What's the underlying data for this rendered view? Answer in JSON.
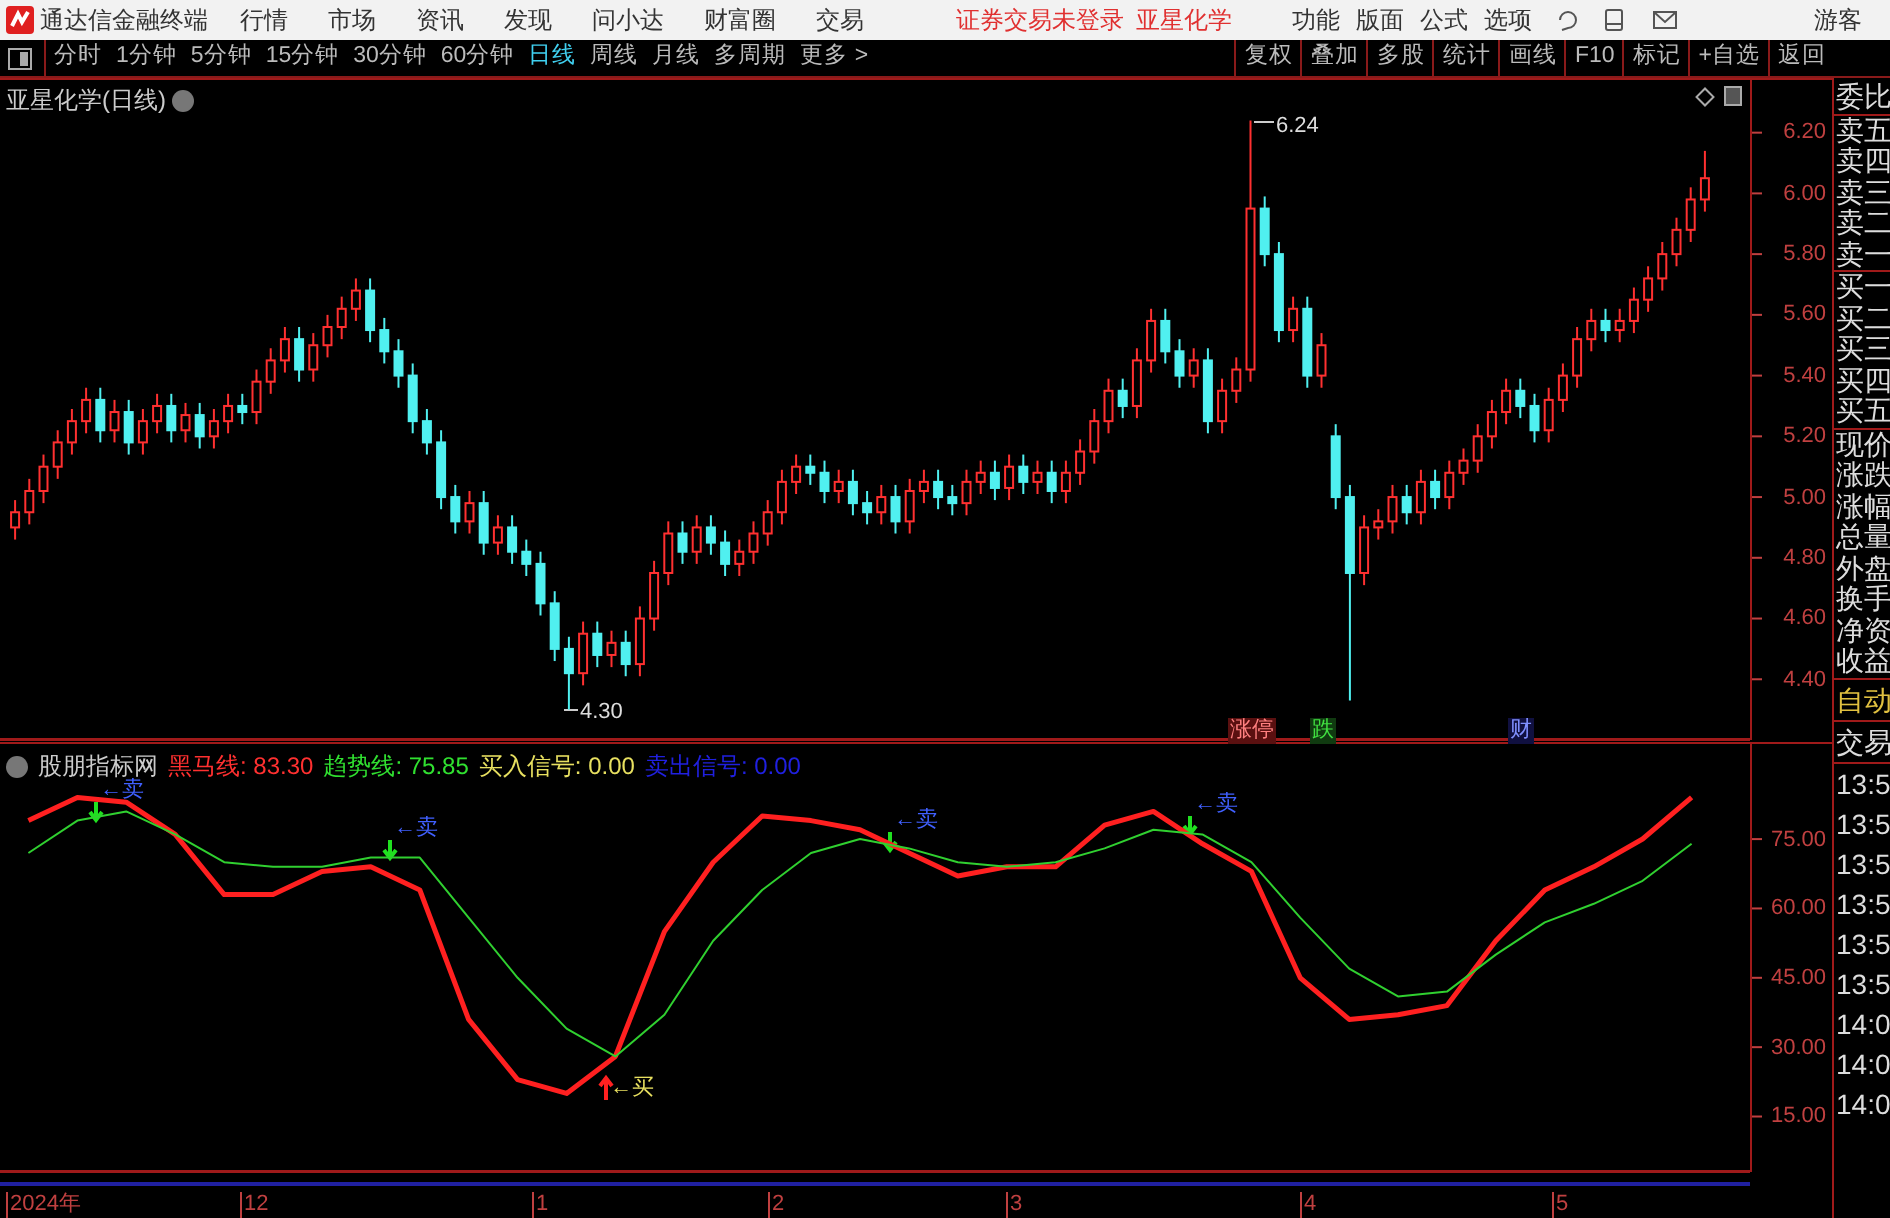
{
  "window": {
    "title": "通达信金融终端"
  },
  "menu": [
    "行情",
    "市场",
    "资讯",
    "发现",
    "问小达",
    "财富圈",
    "交易"
  ],
  "login_status": "证券交易未登录",
  "stock_name": "亚星化学",
  "right_menu": [
    "功能",
    "版面",
    "公式",
    "选项"
  ],
  "user": "游客",
  "periods": [
    {
      "label": "分时",
      "selected": false
    },
    {
      "label": "1分钟",
      "selected": false
    },
    {
      "label": "5分钟",
      "selected": false
    },
    {
      "label": "15分钟",
      "selected": false
    },
    {
      "label": "30分钟",
      "selected": false
    },
    {
      "label": "60分钟",
      "selected": false
    },
    {
      "label": "日线",
      "selected": true
    },
    {
      "label": "周线",
      "selected": false
    },
    {
      "label": "月线",
      "selected": false
    },
    {
      "label": "多周期",
      "selected": false
    },
    {
      "label": "更多 >",
      "selected": false
    }
  ],
  "tools": [
    "复权",
    "叠加",
    "多股",
    "统计",
    "画线",
    "F10",
    "标记",
    "+自选",
    "返回"
  ],
  "chart": {
    "title": "亚星化学(日线)",
    "high_label": "6.24",
    "low_label": "4.30",
    "event_tags": [
      {
        "label": "涨停",
        "kind": "limit_up"
      },
      {
        "label": "跌",
        "kind": "drop"
      },
      {
        "label": "财",
        "kind": "finance"
      }
    ],
    "chart_data": {
      "type": "candlestick",
      "ylim": [
        4.2,
        6.38
      ],
      "yticks": [
        {
          "value": 6.2,
          "label": "6.20"
        },
        {
          "value": 6.0,
          "label": "6.00"
        },
        {
          "value": 5.8,
          "label": "5.80"
        },
        {
          "value": 5.6,
          "label": "5.60"
        },
        {
          "value": 5.4,
          "label": "5.40"
        },
        {
          "value": 5.2,
          "label": "5.20"
        },
        {
          "value": 5.0,
          "label": "5.00"
        },
        {
          "value": 4.8,
          "label": "4.80"
        },
        {
          "value": 4.6,
          "label": "4.60"
        },
        {
          "value": 4.4,
          "label": "4.40"
        }
      ],
      "categories": [
        null,
        null,
        null,
        null,
        null,
        null,
        null,
        null,
        null,
        null,
        null,
        null,
        null,
        null,
        null,
        null,
        null,
        null,
        null,
        null,
        null,
        null,
        null,
        null,
        null,
        null,
        null,
        null,
        null,
        null,
        null,
        null,
        null,
        null,
        null,
        null,
        null,
        null,
        null,
        null,
        null,
        null,
        null,
        null,
        null,
        null,
        null,
        null,
        null,
        null,
        null,
        null,
        null,
        null,
        null,
        null,
        null,
        null,
        null,
        null,
        null,
        null,
        null,
        null,
        null,
        null,
        null,
        null,
        null,
        null,
        null,
        null,
        null,
        null,
        null,
        null,
        null,
        null,
        null,
        null,
        null,
        null,
        null,
        null,
        null,
        null,
        null,
        null,
        null,
        null,
        null,
        null,
        null,
        null,
        null,
        null,
        null,
        null,
        null,
        null,
        null,
        null,
        null,
        null,
        null,
        null,
        null,
        null,
        null,
        null,
        null,
        null,
        null,
        null,
        null,
        null,
        null,
        null,
        null,
        null
      ],
      "ohlc": [
        [
          4.9,
          4.99,
          4.86,
          4.95
        ],
        [
          4.95,
          5.06,
          4.91,
          5.02
        ],
        [
          5.02,
          5.14,
          4.98,
          5.1
        ],
        [
          5.1,
          5.22,
          5.06,
          5.18
        ],
        [
          5.18,
          5.29,
          5.14,
          5.25
        ],
        [
          5.25,
          5.36,
          5.21,
          5.32
        ],
        [
          5.32,
          5.36,
          5.18,
          5.22
        ],
        [
          5.22,
          5.32,
          5.18,
          5.28
        ],
        [
          5.28,
          5.32,
          5.14,
          5.18
        ],
        [
          5.18,
          5.29,
          5.14,
          5.25
        ],
        [
          5.25,
          5.34,
          5.21,
          5.3
        ],
        [
          5.3,
          5.34,
          5.18,
          5.22
        ],
        [
          5.22,
          5.31,
          5.18,
          5.27
        ],
        [
          5.27,
          5.31,
          5.16,
          5.2
        ],
        [
          5.2,
          5.29,
          5.16,
          5.25
        ],
        [
          5.25,
          5.34,
          5.21,
          5.3
        ],
        [
          5.3,
          5.34,
          5.24,
          5.28
        ],
        [
          5.28,
          5.42,
          5.24,
          5.38
        ],
        [
          5.38,
          5.49,
          5.34,
          5.45
        ],
        [
          5.45,
          5.56,
          5.41,
          5.52
        ],
        [
          5.52,
          5.56,
          5.38,
          5.42
        ],
        [
          5.42,
          5.54,
          5.38,
          5.5
        ],
        [
          5.5,
          5.6,
          5.46,
          5.56
        ],
        [
          5.56,
          5.66,
          5.52,
          5.62
        ],
        [
          5.62,
          5.72,
          5.58,
          5.68
        ],
        [
          5.68,
          5.72,
          5.51,
          5.55
        ],
        [
          5.55,
          5.59,
          5.44,
          5.48
        ],
        [
          5.48,
          5.52,
          5.36,
          5.4
        ],
        [
          5.4,
          5.44,
          5.21,
          5.25
        ],
        [
          5.25,
          5.29,
          5.14,
          5.18
        ],
        [
          5.18,
          5.22,
          4.96,
          5.0
        ],
        [
          5.0,
          5.04,
          4.88,
          4.92
        ],
        [
          4.92,
          5.02,
          4.88,
          4.98
        ],
        [
          4.98,
          5.02,
          4.81,
          4.85
        ],
        [
          4.85,
          4.94,
          4.81,
          4.9
        ],
        [
          4.9,
          4.94,
          4.78,
          4.82
        ],
        [
          4.82,
          4.86,
          4.74,
          4.78
        ],
        [
          4.78,
          4.82,
          4.61,
          4.65
        ],
        [
          4.65,
          4.69,
          4.46,
          4.5
        ],
        [
          4.5,
          4.54,
          4.3,
          4.42
        ],
        [
          4.42,
          4.59,
          4.38,
          4.55
        ],
        [
          4.55,
          4.59,
          4.44,
          4.48
        ],
        [
          4.48,
          4.56,
          4.44,
          4.52
        ],
        [
          4.52,
          4.56,
          4.41,
          4.45
        ],
        [
          4.45,
          4.64,
          4.41,
          4.6
        ],
        [
          4.6,
          4.79,
          4.56,
          4.75
        ],
        [
          4.75,
          4.92,
          4.71,
          4.88
        ],
        [
          4.88,
          4.92,
          4.78,
          4.82
        ],
        [
          4.82,
          4.94,
          4.78,
          4.9
        ],
        [
          4.9,
          4.94,
          4.81,
          4.85
        ],
        [
          4.85,
          4.89,
          4.74,
          4.78
        ],
        [
          4.78,
          4.86,
          4.74,
          4.82
        ],
        [
          4.82,
          4.92,
          4.78,
          4.88
        ],
        [
          4.88,
          4.99,
          4.84,
          4.95
        ],
        [
          4.95,
          5.09,
          4.91,
          5.05
        ],
        [
          5.05,
          5.14,
          5.01,
          5.1
        ],
        [
          5.1,
          5.14,
          5.04,
          5.08
        ],
        [
          5.08,
          5.12,
          4.98,
          5.02
        ],
        [
          5.02,
          5.09,
          4.98,
          5.05
        ],
        [
          5.05,
          5.09,
          4.94,
          4.98
        ],
        [
          4.98,
          5.02,
          4.91,
          4.95
        ],
        [
          4.95,
          5.04,
          4.91,
          5.0
        ],
        [
          5.0,
          5.04,
          4.88,
          4.92
        ],
        [
          4.92,
          5.06,
          4.88,
          5.02
        ],
        [
          5.02,
          5.09,
          4.98,
          5.05
        ],
        [
          5.05,
          5.09,
          4.96,
          5.0
        ],
        [
          5.0,
          5.04,
          4.94,
          4.98
        ],
        [
          4.98,
          5.09,
          4.94,
          5.05
        ],
        [
          5.05,
          5.12,
          5.01,
          5.08
        ],
        [
          5.08,
          5.12,
          4.99,
          5.03
        ],
        [
          5.03,
          5.14,
          4.99,
          5.1
        ],
        [
          5.1,
          5.14,
          5.01,
          5.05
        ],
        [
          5.05,
          5.12,
          5.01,
          5.08
        ],
        [
          5.08,
          5.12,
          4.98,
          5.02
        ],
        [
          5.02,
          5.12,
          4.98,
          5.08
        ],
        [
          5.08,
          5.19,
          5.04,
          5.15
        ],
        [
          5.15,
          5.29,
          5.11,
          5.25
        ],
        [
          5.25,
          5.39,
          5.21,
          5.35
        ],
        [
          5.35,
          5.39,
          5.26,
          5.3
        ],
        [
          5.3,
          5.49,
          5.26,
          5.45
        ],
        [
          5.45,
          5.62,
          5.41,
          5.58
        ],
        [
          5.58,
          5.62,
          5.44,
          5.48
        ],
        [
          5.48,
          5.52,
          5.36,
          5.4
        ],
        [
          5.4,
          5.49,
          5.36,
          5.45
        ],
        [
          5.45,
          5.49,
          5.21,
          5.25
        ],
        [
          5.25,
          5.39,
          5.21,
          5.35
        ],
        [
          5.35,
          5.46,
          5.31,
          5.42
        ],
        [
          5.42,
          6.24,
          5.38,
          5.95
        ],
        [
          5.95,
          5.99,
          5.76,
          5.8
        ],
        [
          5.8,
          5.84,
          5.51,
          5.55
        ],
        [
          5.55,
          5.66,
          5.51,
          5.62
        ],
        [
          5.62,
          5.66,
          5.36,
          5.4
        ],
        [
          5.4,
          5.54,
          5.36,
          5.5
        ],
        [
          5.2,
          5.24,
          4.96,
          5.0
        ],
        [
          5.0,
          5.04,
          4.33,
          4.75
        ],
        [
          4.75,
          4.94,
          4.71,
          4.9
        ],
        [
          4.9,
          4.96,
          4.86,
          4.92
        ],
        [
          4.92,
          5.04,
          4.88,
          5.0
        ],
        [
          5.0,
          5.04,
          4.91,
          4.95
        ],
        [
          4.95,
          5.09,
          4.91,
          5.05
        ],
        [
          5.05,
          5.09,
          4.96,
          5.0
        ],
        [
          5.0,
          5.12,
          4.96,
          5.08
        ],
        [
          5.08,
          5.16,
          5.04,
          5.12
        ],
        [
          5.12,
          5.24,
          5.08,
          5.2
        ],
        [
          5.2,
          5.32,
          5.16,
          5.28
        ],
        [
          5.28,
          5.39,
          5.24,
          5.35
        ],
        [
          5.35,
          5.39,
          5.26,
          5.3
        ],
        [
          5.3,
          5.34,
          5.18,
          5.22
        ],
        [
          5.22,
          5.36,
          5.18,
          5.32
        ],
        [
          5.32,
          5.44,
          5.28,
          5.4
        ],
        [
          5.4,
          5.56,
          5.36,
          5.52
        ],
        [
          5.52,
          5.62,
          5.48,
          5.58
        ],
        [
          5.58,
          5.62,
          5.51,
          5.55
        ],
        [
          5.55,
          5.62,
          5.51,
          5.58
        ],
        [
          5.58,
          5.69,
          5.54,
          5.65
        ],
        [
          5.65,
          5.76,
          5.61,
          5.72
        ],
        [
          5.72,
          5.84,
          5.68,
          5.8
        ],
        [
          5.8,
          5.92,
          5.76,
          5.88
        ],
        [
          5.88,
          6.02,
          5.84,
          5.98
        ],
        [
          5.98,
          6.14,
          5.94,
          6.05
        ]
      ]
    }
  },
  "indicator": {
    "name": "股朋指标网",
    "legend": [
      {
        "label": "黑马线: 83.30",
        "color": "#ff3030"
      },
      {
        "label": "趋势线: 75.85",
        "color": "#30e030"
      },
      {
        "label": "买入信号: 0.00",
        "color": "#e8e060"
      },
      {
        "label": "卖出信号: 0.00",
        "color": "#2020e0"
      }
    ],
    "signals": [
      {
        "label": "←卖",
        "kind": "sell"
      },
      {
        "label": "←卖",
        "kind": "sell"
      },
      {
        "label": "←买",
        "kind": "buy"
      },
      {
        "label": "←卖",
        "kind": "sell"
      },
      {
        "label": "←卖",
        "kind": "sell"
      }
    ],
    "chart_data": {
      "type": "line",
      "ylim": [
        3,
        96
      ],
      "categories": [
        null,
        null,
        null,
        null,
        null,
        null,
        null,
        null,
        null,
        null,
        null,
        null,
        null,
        null,
        null,
        null,
        null,
        null,
        null,
        null,
        null,
        null,
        null,
        null,
        null,
        null,
        null,
        null,
        null,
        null,
        null,
        null,
        null,
        null,
        null
      ],
      "yticks": [
        {
          "value": 75,
          "label": "75.00"
        },
        {
          "value": 60,
          "label": "60.00"
        },
        {
          "value": 45,
          "label": "45.00"
        },
        {
          "value": 30,
          "label": "30.00"
        },
        {
          "value": 15,
          "label": "15.00"
        }
      ],
      "series": [
        {
          "color": "#ff2020",
          "values": [
            79,
            84,
            83,
            76,
            63,
            63,
            68,
            69,
            64,
            36,
            23,
            20,
            28,
            55,
            70,
            80,
            79,
            77,
            72,
            67,
            69,
            69,
            78,
            81,
            74,
            68,
            45,
            36,
            37,
            39,
            53,
            64,
            69,
            75,
            84
          ]
        },
        {
          "color": "#30d030",
          "values": [
            72,
            79,
            81,
            76,
            70,
            69,
            69,
            71,
            71,
            58,
            45,
            34,
            28,
            37,
            53,
            64,
            72,
            75,
            73,
            70,
            69,
            70,
            73,
            77,
            76,
            70,
            58,
            47,
            41,
            42,
            50,
            57,
            61,
            66,
            74
          ]
        }
      ]
    }
  },
  "date_axis": [
    "2024年",
    "12",
    "1",
    "2",
    "3",
    "4",
    "5"
  ],
  "side_panel": [
    {
      "label": "委比",
      "kind": "header"
    },
    {
      "label": "卖五",
      "kind": "sell"
    },
    {
      "label": "卖四",
      "kind": "sell"
    },
    {
      "label": "卖三",
      "kind": "sell"
    },
    {
      "label": "卖二",
      "kind": "sell"
    },
    {
      "label": "卖一",
      "kind": "sell"
    },
    {
      "label": "买一",
      "kind": "buy"
    },
    {
      "label": "买二",
      "kind": "buy"
    },
    {
      "label": "买三",
      "kind": "buy"
    },
    {
      "label": "买四",
      "kind": "buy"
    },
    {
      "label": "买五",
      "kind": "buy"
    },
    {
      "label": "现价",
      "kind": "quote"
    },
    {
      "label": "涨跌",
      "kind": "quote"
    },
    {
      "label": "涨幅",
      "kind": "quote"
    },
    {
      "label": "总量",
      "kind": "quote"
    },
    {
      "label": "外盘",
      "kind": "quote"
    },
    {
      "label": "换手",
      "kind": "quote"
    },
    {
      "label": "净资",
      "kind": "quote"
    },
    {
      "label": "收益",
      "kind": "quote"
    },
    {
      "label": "自动",
      "kind": "auto"
    },
    {
      "label": "交易",
      "kind": "trade"
    },
    {
      "label": "13:5",
      "kind": "time"
    },
    {
      "label": "13:5",
      "kind": "time"
    },
    {
      "label": "13:5",
      "kind": "time"
    },
    {
      "label": "13:5",
      "kind": "time"
    },
    {
      "label": "13:5",
      "kind": "time"
    },
    {
      "label": "13:5",
      "kind": "time"
    },
    {
      "label": "14:0",
      "kind": "time"
    },
    {
      "label": "14:0",
      "kind": "time"
    },
    {
      "label": "14:0",
      "kind": "time"
    }
  ]
}
